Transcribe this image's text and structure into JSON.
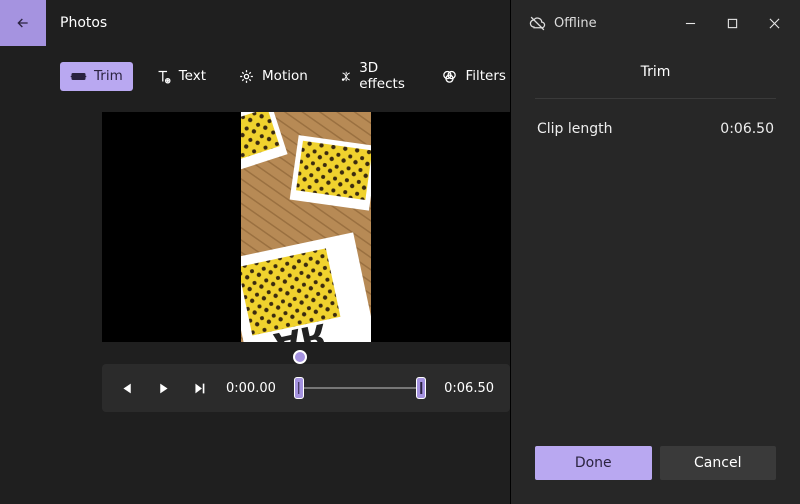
{
  "app_title": "Photos",
  "offline_label": "Offline",
  "tools": {
    "trim": "Trim",
    "text": "Text",
    "motion": "Motion",
    "effects": "3D effects",
    "filters": "Filters"
  },
  "playback": {
    "current_time": "0:00.00",
    "end_time": "0:06.50"
  },
  "panel": {
    "title": "Trim",
    "clip_length_label": "Clip length",
    "clip_length_value": "0:06.50",
    "done_label": "Done",
    "cancel_label": "Cancel"
  },
  "colors": {
    "accent": "#a593e0",
    "bg": "#1f1f1f",
    "panel": "#272727"
  }
}
